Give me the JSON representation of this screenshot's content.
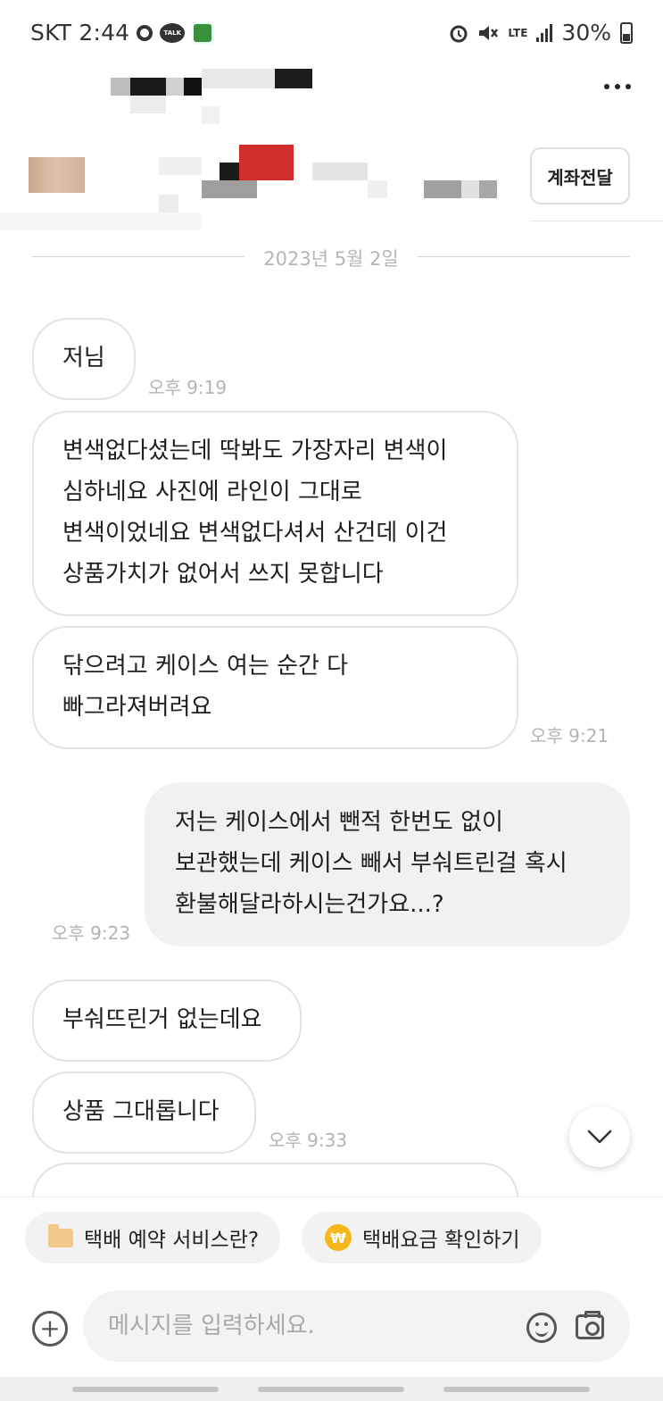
{
  "status_bar": {
    "carrier_time": "SKT 2:44",
    "talk_label": "TALK",
    "network": "LTE",
    "battery": "30%"
  },
  "header": {
    "transfer_button": "계좌전달"
  },
  "date_divider": "2023년 5월 2일",
  "messages": [
    {
      "text": "저님",
      "time": "오후 9:19",
      "sender": "other"
    },
    {
      "text": "변색없다셨는데 딱봐도 가장자리 변색이\n심하네요 사진에 라인이 그대로\n변색이었네요 변색없다셔서 산건데 이건\n상품가치가 없어서 쓰지 못합니다",
      "sender": "other"
    },
    {
      "text": "닦으려고 케이스 여는 순간 다\n빠그라져버려요",
      "time": "오후 9:21",
      "sender": "other"
    },
    {
      "text": "저는 케이스에서 뺀적 한번도 없이\n보관했는데 케이스 빼서 부숴트린걸 혹시\n환불해달라하시는건가요...?",
      "time": "오후 9:23",
      "sender": "me"
    },
    {
      "text": "부숴뜨린거 없는데요",
      "sender": "other"
    },
    {
      "text": "상품 그대롭니다",
      "time": "오후 9:33",
      "sender": "other"
    }
  ],
  "quick_actions": [
    {
      "label": "택배 예약 서비스란?",
      "icon": "folder-icon"
    },
    {
      "label": "택배요금 확인하기",
      "icon": "won-coin-icon"
    }
  ],
  "input": {
    "placeholder": "메시지를 입력하세요."
  },
  "colors": {
    "my_bubble": "#f1f1f3",
    "other_bubble_border": "#e2e2e2",
    "time_text": "#b3b3b3"
  }
}
